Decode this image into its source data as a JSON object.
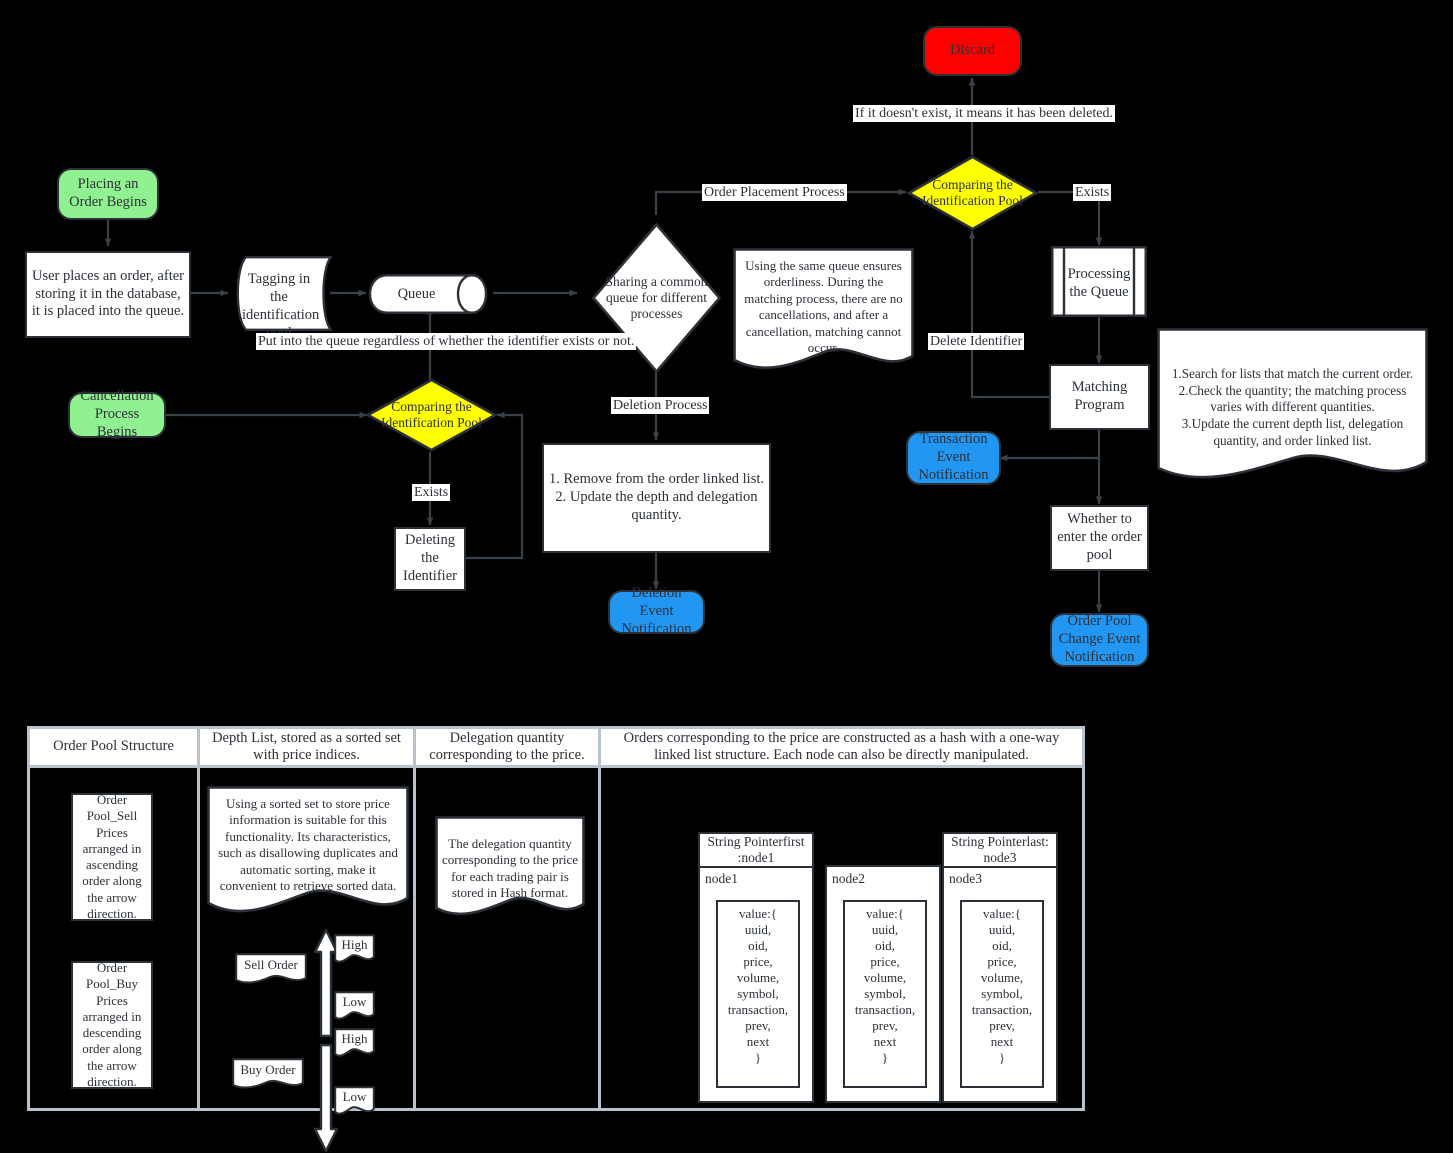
{
  "flow": {
    "nodes": {
      "place_order_start": "Placing an Order Begins",
      "user_places": "User places an order, after storing it in the database, it is placed into the queue.",
      "tagging_pool": "Tagging in the identification pool",
      "queue": "Queue",
      "sharing_queue": "Sharing a common queue for different processes",
      "queue_note": "Using the same queue ensures orderliness. During the matching process, there are no cancellations, and after a cancellation, matching cannot occur.",
      "cancellation_start": "Cancellation Process Begins",
      "compare_pool_left": "Comparing the Identification Pool",
      "deleting_identifier": "Deleting the Identifier",
      "deletion_steps": "1. Remove from the order linked list.\n2. Update the depth and delegation quantity.",
      "deletion_event": "Deletion Event Notification",
      "discard": "Discard",
      "compare_pool_right": "Comparing the Identification Pool",
      "processing_queue": "Processing the Queue",
      "matching_program": "Matching Program",
      "matching_note": "1.Search for lists that match the current order.\n2.Check the quantity; the matching process varies with different quantities.\n3.Update the current depth list, delegation quantity, and order linked list.",
      "transaction_event": "Transaction Event Notification",
      "whether_enter_pool": "Whether to enter the order pool",
      "order_pool_event": "Order Pool Change Event Notification"
    },
    "edge_labels": {
      "put_into_queue": "Put into the queue regardless of whether the identifier exists or not.",
      "order_placement_process": "Order Placement Process",
      "deletion_process": "Deletion Process",
      "exists_left": "Exists",
      "exists_right": "Exists",
      "if_not_exist": "If it doesn't exist, it means it has been deleted.",
      "delete_identifier": "Delete Identifier"
    }
  },
  "table": {
    "columns": [
      {
        "header": "Order Pool Structure"
      },
      {
        "header": "Depth List, stored as a sorted set with price indices."
      },
      {
        "header": "Delegation quantity corresponding to the price."
      },
      {
        "header": "Orders corresponding to the price are constructed as a hash with a one-way linked list structure. Each node can also be directly manipulated."
      }
    ],
    "order_pool": {
      "sell": "Order Pool_Sell\nPrices arranged in ascending order along the arrow direction.",
      "buy": "Order Pool_Buy\nPrices arranged in descending order along the arrow direction."
    },
    "depth_list": {
      "note": "Using a sorted set to store price information is suitable for this functionality. Its characteristics, such as disallowing duplicates and automatic sorting, make it convenient to retrieve sorted data.",
      "sell_order": "Sell Order",
      "buy_order": "Buy Order",
      "sell_high": "High",
      "sell_low": "Low",
      "buy_high": "High",
      "buy_low": "Low"
    },
    "delegation": {
      "note": "The delegation quantity corresponding to the price for each trading pair is stored in Hash format."
    },
    "linked_list": {
      "pointer_first": "String Pointerfirst :node1",
      "pointer_last": "String Pointerlast: node3",
      "nodes": [
        {
          "title": "node1",
          "value": "value:{\n uuid,\n oid,\n price,\n volume,\n symbol,\ntransaction,\n prev,\n next\n}"
        },
        {
          "title": "node2",
          "value": "value:{\n uuid,\n oid,\n price,\n volume,\n symbol,\ntransaction,\n prev,\n next\n}"
        },
        {
          "title": "node3",
          "value": "value:{\n uuid,\n oid,\n price,\n volume,\n symbol,\ntransaction,\n prev,\n next\n}"
        }
      ]
    }
  },
  "colors": {
    "start": "#8ff18f",
    "discard": "#ff0000",
    "event": "#2196f3",
    "decision": "#ffff00",
    "stroke": "#2c3137",
    "background": "#000000"
  }
}
